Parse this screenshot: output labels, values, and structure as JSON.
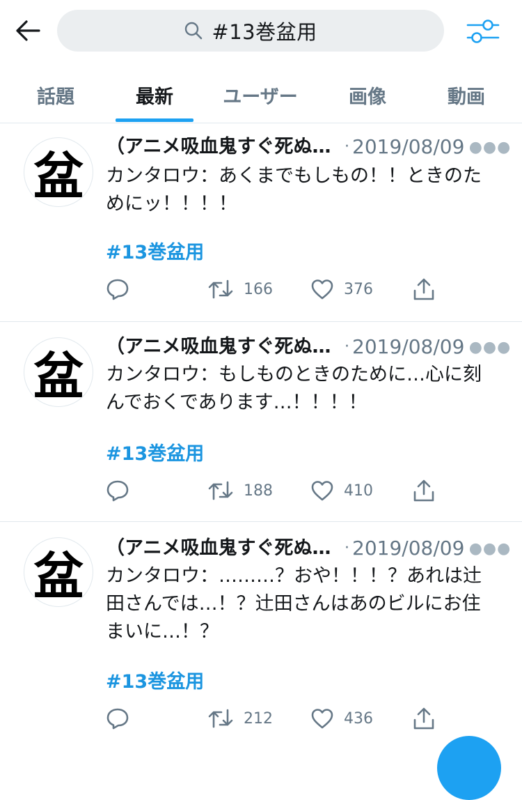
{
  "search": {
    "query": "#13巻盆用"
  },
  "tabs": [
    {
      "label": "話題"
    },
    {
      "label": "最新"
    },
    {
      "label": "ユーザー"
    },
    {
      "label": "画像"
    },
    {
      "label": "動画"
    }
  ],
  "active_tab": "最新",
  "tweets": [
    {
      "author": "（アニメ吸血鬼すぐ死ぬ二期決定",
      "date": "2019/08/09",
      "text": "カンタロウ：あくまでもしもの！！ときのた\nめにッ！！！！",
      "hashtag": "#13巻盆用",
      "retweets": "166",
      "likes": "376"
    },
    {
      "author": "（アニメ吸血鬼すぐ死ぬ二期決定",
      "date": "2019/08/09",
      "text": "カンタロウ：もしものときのために…心に刻\nんでおくであります…！！！！",
      "hashtag": "#13巻盆用",
      "retweets": "188",
      "likes": "410"
    },
    {
      "author": "（アニメ吸血鬼すぐ死ぬ二期決定",
      "date": "2019/08/09",
      "text": "カンタロウ：………？おや！！！？あれは辻\n田さんでは…！？辻田さんはあのビルにお住\nまいに…！？",
      "hashtag": "#13巻盆用",
      "retweets": "212",
      "likes": "436"
    }
  ],
  "avatar_glyph": "盆",
  "colors": {
    "accent": "#1da1f2",
    "hashtag": "#1b95e0",
    "muted": "#657786"
  }
}
